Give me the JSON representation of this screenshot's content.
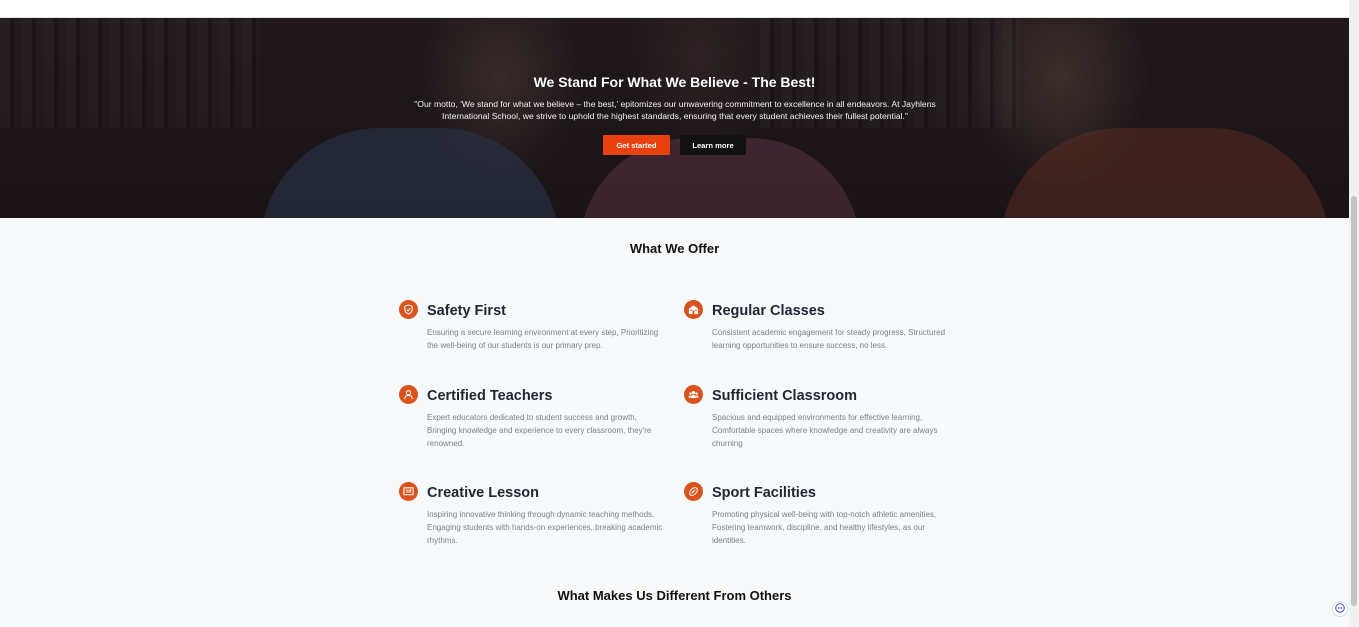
{
  "hero": {
    "title": "We Stand For What We Believe - The Best!",
    "text": "\"Our motto, 'We stand for what we believe – the best,' epitomizes our unwavering commitment to excellence in all endeavors. At Jayhlens International School, we strive to uphold the highest standards, ensuring that every student achieves their fullest potential.\"",
    "primary_button": "Get started",
    "secondary_button": "Learn more"
  },
  "offer": {
    "title": "What We Offer",
    "features": [
      {
        "icon": "shield-icon",
        "title": "Safety First",
        "text": "Ensuring a secure learning environment at every step, Prioritizing the well-being of our students is our primary prep."
      },
      {
        "icon": "school-building-icon",
        "title": "Regular Classes",
        "text": "Consistent academic engagement for steady progress, Structured learning opportunities to ensure success, no less."
      },
      {
        "icon": "teacher-icon",
        "title": "Certified Teachers",
        "text": "Expert educators dedicated to student success and growth, Bringing knowledge and experience to every classroom, they're renowned."
      },
      {
        "icon": "group-icon",
        "title": "Sufficient Classroom",
        "text": "Spacious and equipped environments for effective learning, Comfortable spaces where knowledge and creativity are always churning"
      },
      {
        "icon": "board-icon",
        "title": "Creative Lesson",
        "text": "Inspiring innovative thinking through dynamic teaching methods, Engaging students with hands-on experiences, breaking academic rhythms."
      },
      {
        "icon": "ball-icon",
        "title": "Sport Facilities",
        "text": "Promoting physical well-being with top-notch athletic amenities, Fostering teamwork, discipline, and healthy lifestyles, as our identities."
      }
    ]
  },
  "different": {
    "title": "What Makes Us Different From Others"
  },
  "colors": {
    "accent": "#e8400f",
    "icon_bg": "#d9531e",
    "dark_button": "#111111"
  }
}
